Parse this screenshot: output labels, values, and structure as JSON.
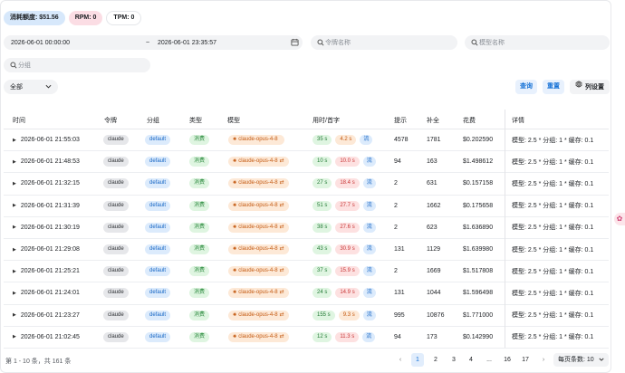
{
  "stats": {
    "consumed": "消耗额度: $51.56",
    "rpm": "RPM: 0",
    "tpm": "TPM: 0"
  },
  "filters": {
    "start_date": "2026-06-01 00:00:00",
    "separator": "~",
    "end_date": "2026-06-01 23:35:57",
    "token_placeholder": "令牌名称",
    "model_placeholder": "模型名称",
    "group_placeholder": "分组",
    "type_select": "全部"
  },
  "buttons": {
    "query": "查询",
    "reset": "重置",
    "columns": "列设置"
  },
  "table": {
    "headers": {
      "time": "时间",
      "token": "令牌",
      "group": "分组",
      "type": "类型",
      "model": "模型",
      "latency": "用时/首字",
      "prompt": "提示",
      "completion": "补全",
      "cost": "花费",
      "detail": "详情"
    },
    "rows": [
      {
        "time": "2026-06-01 21:55:03",
        "token": "claude",
        "group": "default",
        "type": "消费",
        "model": "claude-opus-4-8",
        "model_arrow": "",
        "use_time": "35 s",
        "first_token": "4.2 s",
        "ft_color": "orange",
        "stream": "流",
        "prompt": "4578",
        "completion": "1781",
        "cost": "$0.202590",
        "detail": "模型: 2.5 * 分组: 1 * 缓存: 0.1"
      },
      {
        "time": "2026-06-01 21:48:53",
        "token": "claude",
        "group": "default",
        "type": "消费",
        "model": "claude-opus-4-8",
        "model_arrow": "⇄",
        "use_time": "10 s",
        "first_token": "10.0 s",
        "ft_color": "red",
        "stream": "流",
        "prompt": "94",
        "completion": "163",
        "cost": "$1.498612",
        "detail": "模型: 2.5 * 分组: 1 * 缓存: 0.1"
      },
      {
        "time": "2026-06-01 21:32:15",
        "token": "claude",
        "group": "default",
        "type": "消费",
        "model": "claude-opus-4-8",
        "model_arrow": "⇄",
        "use_time": "27 s",
        "first_token": "18.4 s",
        "ft_color": "red",
        "stream": "流",
        "prompt": "2",
        "completion": "631",
        "cost": "$0.157158",
        "detail": "模型: 2.5 * 分组: 1 * 缓存: 0.1"
      },
      {
        "time": "2026-06-01 21:31:39",
        "token": "claude",
        "group": "default",
        "type": "消费",
        "model": "claude-opus-4-8",
        "model_arrow": "⇄",
        "use_time": "51 s",
        "first_token": "27.7 s",
        "ft_color": "red",
        "stream": "流",
        "prompt": "2",
        "completion": "1662",
        "cost": "$0.175658",
        "detail": "模型: 2.5 * 分组: 1 * 缓存: 0.1"
      },
      {
        "time": "2026-06-01 21:30:19",
        "token": "claude",
        "group": "default",
        "type": "消费",
        "model": "claude-opus-4-8",
        "model_arrow": "⇄",
        "use_time": "38 s",
        "first_token": "27.6 s",
        "ft_color": "red",
        "stream": "流",
        "prompt": "2",
        "completion": "623",
        "cost": "$1.636890",
        "detail": "模型: 2.5 * 分组: 1 * 缓存: 0.1"
      },
      {
        "time": "2026-06-01 21:29:08",
        "token": "claude",
        "group": "default",
        "type": "消费",
        "model": "claude-opus-4-8",
        "model_arrow": "⇄",
        "use_time": "43 s",
        "first_token": "30.9 s",
        "ft_color": "red",
        "stream": "流",
        "prompt": "131",
        "completion": "1129",
        "cost": "$1.639980",
        "detail": "模型: 2.5 * 分组: 1 * 缓存: 0.1"
      },
      {
        "time": "2026-06-01 21:25:21",
        "token": "claude",
        "group": "default",
        "type": "消费",
        "model": "claude-opus-4-8",
        "model_arrow": "⇄",
        "use_time": "37 s",
        "first_token": "15.9 s",
        "ft_color": "red",
        "stream": "流",
        "prompt": "2",
        "completion": "1669",
        "cost": "$1.517808",
        "detail": "模型: 2.5 * 分组: 1 * 缓存: 0.1"
      },
      {
        "time": "2026-06-01 21:24:01",
        "token": "claude",
        "group": "default",
        "type": "消费",
        "model": "claude-opus-4-8",
        "model_arrow": "⇄",
        "use_time": "24 s",
        "first_token": "14.9 s",
        "ft_color": "red",
        "stream": "流",
        "prompt": "131",
        "completion": "1044",
        "cost": "$1.596498",
        "detail": "模型: 2.5 * 分组: 1 * 缓存: 0.1"
      },
      {
        "time": "2026-06-01 21:23:27",
        "token": "claude",
        "group": "default",
        "type": "消费",
        "model": "claude-opus-4-8",
        "model_arrow": "⇄",
        "use_time": "155 s",
        "first_token": "9.3 s",
        "ft_color": "orange",
        "stream": "流",
        "prompt": "995",
        "completion": "10876",
        "cost": "$1.771000",
        "detail": "模型: 2.5 * 分组: 1 * 缓存: 0.1"
      },
      {
        "time": "2026-06-01 21:02:45",
        "token": "claude",
        "group": "default",
        "type": "消费",
        "model": "claude-opus-4-8",
        "model_arrow": "⇄",
        "use_time": "12 s",
        "first_token": "11.3 s",
        "ft_color": "red",
        "stream": "流",
        "prompt": "94",
        "completion": "173",
        "cost": "$0.142990",
        "detail": "模型: 2.5 * 分组: 1 * 缓存: 0.1"
      }
    ]
  },
  "footer": {
    "summary": "第 1 - 10 条，共 161 条",
    "pages": [
      "1",
      "2",
      "3",
      "4",
      "...",
      "16",
      "17"
    ],
    "active_page": "1",
    "page_size": "每页条数: 10"
  },
  "icons": {
    "search": "search-icon",
    "calendar": "calendar-icon",
    "gear": "gear-icon",
    "spark": "claude-spark-icon"
  },
  "colors": {
    "accent": "#1672d6",
    "stat_blue": "#d7e8fb",
    "stat_pink": "#fbdde4",
    "tag_green": "#dff5e1",
    "tag_red": "#fde1e1",
    "tag_orange": "#fde9d7"
  }
}
